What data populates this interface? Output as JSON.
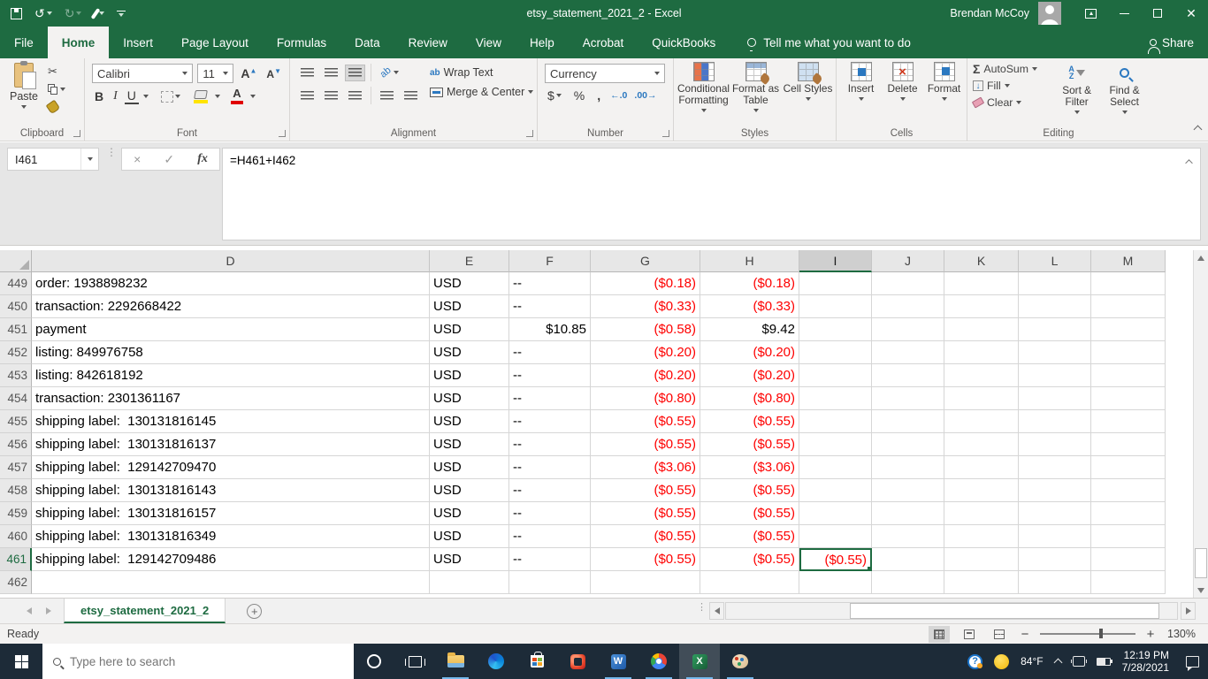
{
  "colors": {
    "accent": "#1e6b41",
    "negative": "#fe0000",
    "taskbar": "#1d2b38",
    "running_indicator": "#76b9ed"
  },
  "titlebar": {
    "title": "etsy_statement_2021_2  -  Excel",
    "user": "Brendan McCoy"
  },
  "menu": {
    "tabs": [
      "File",
      "Home",
      "Insert",
      "Page Layout",
      "Formulas",
      "Data",
      "Review",
      "View",
      "Help",
      "Acrobat",
      "QuickBooks"
    ],
    "active_tab": "Home",
    "tell_me": "Tell me what you want to do",
    "share": "Share"
  },
  "ribbon": {
    "clipboard": {
      "label": "Clipboard",
      "paste": "Paste"
    },
    "font": {
      "label": "Font",
      "name": "Calibri",
      "size": "11",
      "bold": "B",
      "italic": "I",
      "underline": "U"
    },
    "alignment": {
      "label": "Alignment",
      "wrap": "Wrap Text",
      "merge": "Merge & Center",
      "ab": "ab"
    },
    "number": {
      "label": "Number",
      "format": "Currency",
      "dollar": "$",
      "percent": "%",
      "comma": ",",
      "inc_decimal": "←.0",
      "dec_decimal": ".00→"
    },
    "styles": {
      "label": "Styles",
      "cond": "Conditional Formatting",
      "fmt_table": "Format as Table",
      "cell_styles": "Cell Styles"
    },
    "cells": {
      "label": "Cells",
      "insert": "Insert",
      "delete": "Delete",
      "format": "Format"
    },
    "editing": {
      "label": "Editing",
      "autosum": "AutoSum",
      "fill": "Fill",
      "clear": "Clear",
      "sort": "Sort & Filter",
      "find": "Find & Select"
    }
  },
  "formula_bar": {
    "name_box": "I461",
    "formula": "=H461+I462"
  },
  "grid": {
    "columns": [
      "D",
      "E",
      "F",
      "G",
      "H",
      "I",
      "J",
      "K",
      "L",
      "M"
    ],
    "selected_column": "I",
    "selected_row": "461",
    "rows": [
      {
        "n": "449",
        "cells": [
          "order: 1938898232",
          "USD",
          "--",
          "($0.18)",
          "($0.18)",
          "",
          "",
          "",
          "",
          ""
        ]
      },
      {
        "n": "450",
        "cells": [
          "transaction: 2292668422",
          "USD",
          "--",
          "($0.33)",
          "($0.33)",
          "",
          "",
          "",
          "",
          ""
        ]
      },
      {
        "n": "451",
        "cells": [
          "payment",
          "USD",
          "$10.85",
          "($0.58)",
          "$9.42",
          "",
          "",
          "",
          "",
          ""
        ]
      },
      {
        "n": "452",
        "cells": [
          "listing: 849976758",
          "USD",
          "--",
          "($0.20)",
          "($0.20)",
          "",
          "",
          "",
          "",
          ""
        ]
      },
      {
        "n": "453",
        "cells": [
          "listing: 842618192",
          "USD",
          "--",
          "($0.20)",
          "($0.20)",
          "",
          "",
          "",
          "",
          ""
        ]
      },
      {
        "n": "454",
        "cells": [
          "transaction: 2301361167",
          "USD",
          "--",
          "($0.80)",
          "($0.80)",
          "",
          "",
          "",
          "",
          ""
        ]
      },
      {
        "n": "455",
        "cells": [
          "shipping label:  130131816145",
          "USD",
          "--",
          "($0.55)",
          "($0.55)",
          "",
          "",
          "",
          "",
          ""
        ]
      },
      {
        "n": "456",
        "cells": [
          "shipping label:  130131816137",
          "USD",
          "--",
          "($0.55)",
          "($0.55)",
          "",
          "",
          "",
          "",
          ""
        ]
      },
      {
        "n": "457",
        "cells": [
          "shipping label:  129142709470",
          "USD",
          "--",
          "($3.06)",
          "($3.06)",
          "",
          "",
          "",
          "",
          ""
        ]
      },
      {
        "n": "458",
        "cells": [
          "shipping label:  130131816143",
          "USD",
          "--",
          "($0.55)",
          "($0.55)",
          "",
          "",
          "",
          "",
          ""
        ]
      },
      {
        "n": "459",
        "cells": [
          "shipping label:  130131816157",
          "USD",
          "--",
          "($0.55)",
          "($0.55)",
          "",
          "",
          "",
          "",
          ""
        ]
      },
      {
        "n": "460",
        "cells": [
          "shipping label:  130131816349",
          "USD",
          "--",
          "($0.55)",
          "($0.55)",
          "",
          "",
          "",
          "",
          ""
        ]
      },
      {
        "n": "461",
        "cells": [
          "shipping label:  129142709486",
          "USD",
          "--",
          "($0.55)",
          "($0.55)",
          "($0.55)",
          "",
          "",
          "",
          ""
        ]
      },
      {
        "n": "462",
        "cells": [
          "",
          "",
          "",
          "",
          "",
          "",
          "",
          "",
          "",
          ""
        ]
      }
    ]
  },
  "sheet_bar": {
    "tab": "etsy_statement_2021_2"
  },
  "status_bar": {
    "ready": "Ready",
    "zoom": "130%"
  },
  "taskbar": {
    "search_placeholder": "Type here to search",
    "temperature": "84°F",
    "time": "12:19 PM",
    "date": "7/28/2021"
  },
  "icons": {
    "undo": "↺",
    "redo": "↻",
    "scissors": "✂",
    "check": "✓",
    "x": "×",
    "fx": "fx",
    "sigma": "Σ",
    "plus": "+",
    "minus": "−",
    "close": "✕",
    "sortA": "A",
    "sortZ": "Z",
    "a_up": "A",
    "a_down": "A",
    "dots_v": "⋮",
    "word": "W",
    "excel": "X",
    "question": "?"
  }
}
